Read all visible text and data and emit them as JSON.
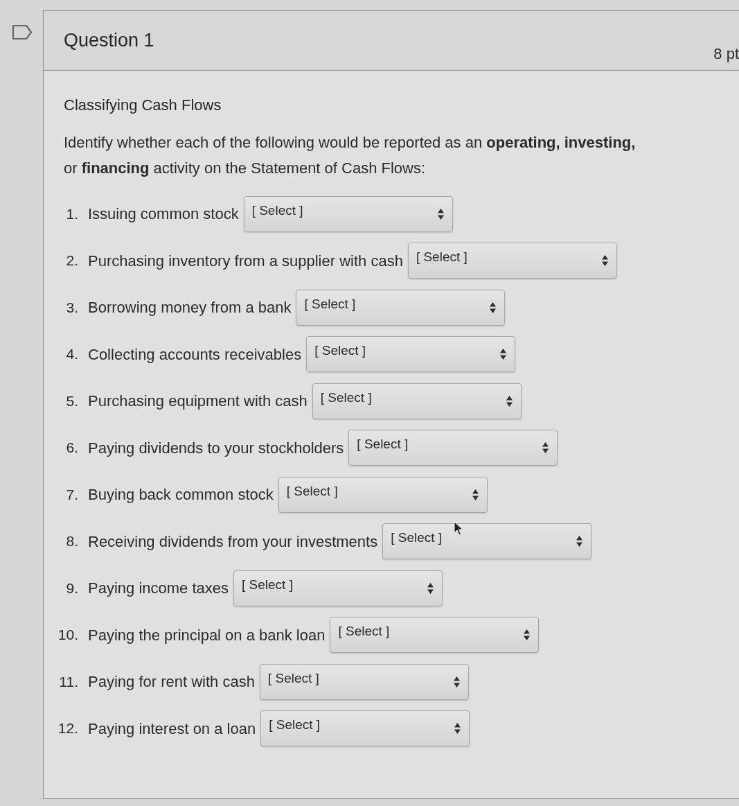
{
  "question": {
    "title": "Question 1",
    "points": "8 pt",
    "flagged": false
  },
  "heading": "Classifying Cash Flows",
  "instructions": "Identify whether each of the following would be reported as an **operating, investing,** or **financing** activity on the Statement of Cash Flows:",
  "items": [
    {
      "number": "1.",
      "text": "Issuing common stock",
      "answer": "[ Select ]"
    },
    {
      "number": "2.",
      "text": "Purchasing inventory from a supplier with cash",
      "answer": "[ Select ]"
    },
    {
      "number": "3.",
      "text": "Borrowing money from a bank",
      "answer": "[ Select ]"
    },
    {
      "number": "4.",
      "text": "Collecting accounts receivables",
      "answer": "[ Select ]"
    },
    {
      "number": "5.",
      "text": "Purchasing equipment with cash",
      "answer": "[ Select ]"
    },
    {
      "number": "6.",
      "text": "Paying dividends to your stockholders",
      "answer": "[ Select ]"
    },
    {
      "number": "7.",
      "text": "Buying back common stock",
      "answer": "[ Select ]"
    },
    {
      "number": "8.",
      "text": "Receiving dividends from your investments",
      "answer": "[ Select ]"
    },
    {
      "number": "9.",
      "text": "Paying income taxes",
      "answer": "[ Select ]"
    },
    {
      "number": "10.",
      "text": "Paying the principal on a bank loan",
      "answer": "[ Select ]"
    },
    {
      "number": "11.",
      "text": "Paying for rent with cash",
      "answer": "[ Select ]"
    },
    {
      "number": "12.",
      "text": "Paying interest on a loan",
      "answer": "[ Select ]"
    }
  ]
}
